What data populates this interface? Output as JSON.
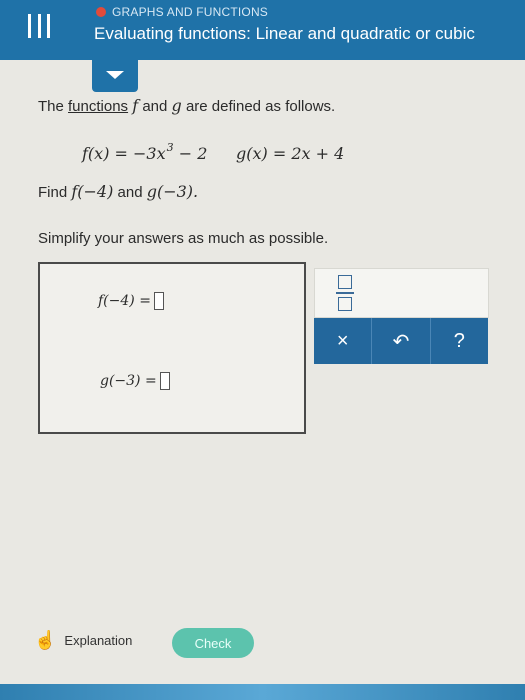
{
  "header": {
    "section": "GRAPHS AND FUNCTIONS",
    "title": "Evaluating functions: Linear and quadratic or cubic"
  },
  "problem": {
    "intro_before": "The ",
    "intro_link": "functions",
    "intro_f": "f",
    "intro_and": "and",
    "intro_g": "g",
    "intro_after": "are defined as follows.",
    "f_definition_lhs": "f(x) = −3x",
    "f_definition_exp": "3",
    "f_definition_rhs": "− 2",
    "g_definition": "g(x) = 2x + 4",
    "find_label": "Find",
    "find_f": "f(−4)",
    "find_and": "and",
    "find_g": "g(−3).",
    "simplify": "Simplify your answers as much as possible."
  },
  "answers": {
    "f_prompt": "f(−4) =",
    "g_prompt": "g(−3) ="
  },
  "keypad": {
    "clear": "×",
    "undo": "↶",
    "help": "?"
  },
  "footer": {
    "explanation": "Explanation",
    "check": "Check"
  },
  "colors": {
    "header": "#1f72a8",
    "keypad": "#23679c",
    "check": "#5cc3ad",
    "section_dot": "#e24b3b"
  }
}
